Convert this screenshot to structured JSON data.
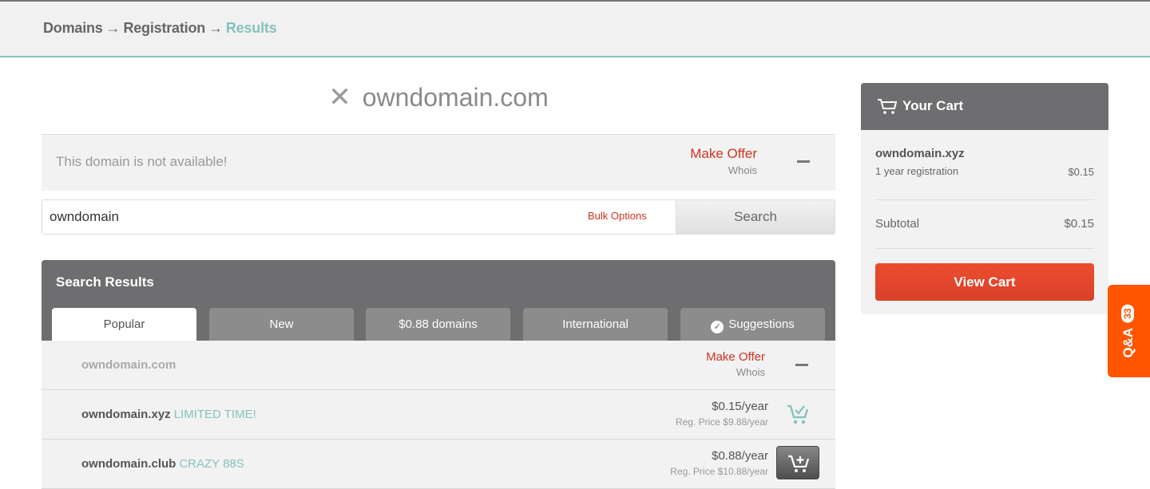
{
  "breadcrumb": {
    "items": [
      "Domains",
      "Registration",
      "Results"
    ],
    "separator": "→"
  },
  "hero": {
    "domain": "owndomain.com",
    "status_icon": "x-icon"
  },
  "availability": {
    "message": "This domain is not available!",
    "make_offer": "Make Offer",
    "whois": "Whois"
  },
  "search": {
    "value": "owndomain",
    "bulk_options": "Bulk Options",
    "button": "Search"
  },
  "results": {
    "title": "Search Results",
    "tabs": [
      {
        "label": "Popular",
        "active": true
      },
      {
        "label": "New",
        "active": false
      },
      {
        "label": "$0.88 domains",
        "active": false
      },
      {
        "label": "International",
        "active": false
      },
      {
        "label": "Suggestions",
        "active": false,
        "icon": "check-circle-icon"
      }
    ],
    "rows": [
      {
        "domain": "owndomain.com",
        "tag": "",
        "make_offer": "Make Offer",
        "whois": "Whois",
        "available": false
      },
      {
        "domain": "owndomain.xyz",
        "tag": "LIMITED TIME!",
        "price": "$0.15/year",
        "reg_price": "Reg. Price $9.88/year",
        "in_cart": true
      },
      {
        "domain": "owndomain.club",
        "tag": "CRAZY 88S",
        "price": "$0.88/year",
        "reg_price": "Reg. Price $10.88/year",
        "in_cart": false
      }
    ]
  },
  "cart": {
    "title": "Your Cart",
    "items": [
      {
        "name": "owndomain.xyz",
        "description": "1 year registration",
        "price": "$0.15"
      }
    ],
    "subtotal_label": "Subtotal",
    "subtotal_value": "$0.15",
    "view_cart": "View Cart"
  },
  "qa_tab": {
    "label": "Q&A",
    "count": "33"
  },
  "colors": {
    "accent_teal": "#86c2bf",
    "offer_red": "#d0341f",
    "cta_orange": "#e8482c",
    "qa_orange": "#ff5400",
    "header_gray": "#6e6e70"
  }
}
